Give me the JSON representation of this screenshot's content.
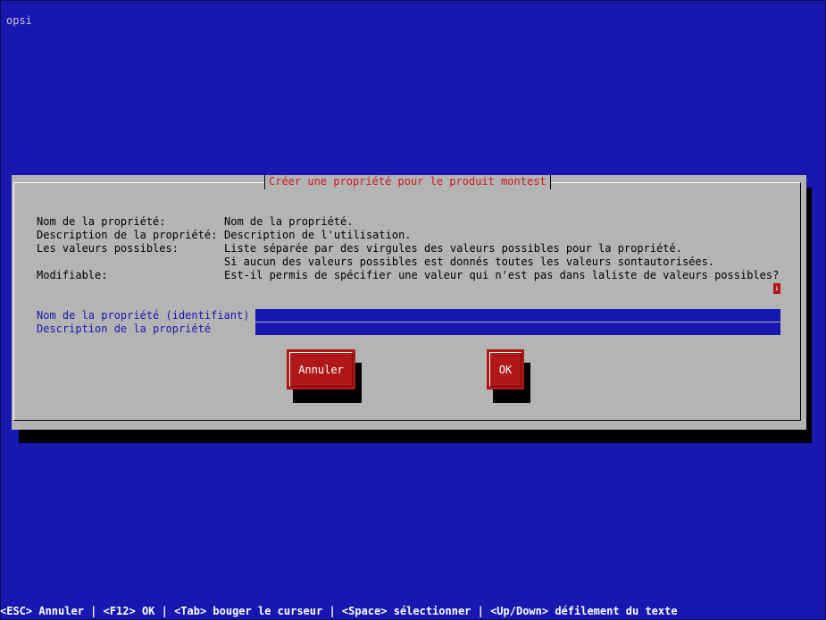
{
  "app": {
    "title": "opsi"
  },
  "dialog": {
    "title": "Créer une propriété pour le produit montest",
    "info": {
      "rows": [
        {
          "label": "Nom de la propriété:",
          "text": "Nom de la propriété."
        },
        {
          "label": "Description de la propriété:",
          "text": "Description de l'utilisation."
        },
        {
          "label": "Les valeurs possibles:",
          "text": "Liste séparée par des virgules des valeurs possibles pour la propriété."
        },
        {
          "label": "",
          "text": "Si aucun des valeurs possibles est donnés toutes les valeurs sontautorisées."
        },
        {
          "label": "Modifiable:",
          "text": "Est-il permis de spécifier une valeur qui n'est pas dans laliste de valeurs possibles?"
        }
      ],
      "scroll_indicator": "↓"
    },
    "fields": [
      {
        "label": "Nom de la propriété (identifiant)",
        "value": ""
      },
      {
        "label": "Description de la propriété",
        "value": ""
      }
    ],
    "buttons": {
      "cancel": "Annuler",
      "ok": "OK"
    }
  },
  "help_bar": "<ESC> Annuler | <F12> OK | <Tab> bouger le curseur | <Space> sélectionner | <Up/Down> défilement du texte",
  "colors": {
    "background": "#1818b0",
    "dialog": "#b4b4b4",
    "title_text": "#c81e1e",
    "button": "#b01818",
    "field_label": "#1818b0"
  }
}
